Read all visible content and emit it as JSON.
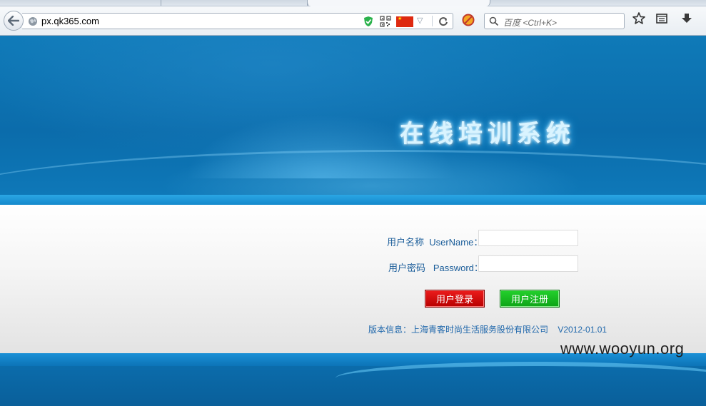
{
  "browser": {
    "url": "px.qk365.com",
    "search_placeholder": "百度 <Ctrl+K>",
    "icons": [
      "back-arrow-icon",
      "globe-icon",
      "shield-icon",
      "qr-code-icon",
      "china-flag-icon",
      "dropdown-arrow-icon",
      "reload-icon",
      "adblock-icon",
      "search-icon",
      "bookmark-star-icon",
      "reader-icon",
      "download-icon"
    ]
  },
  "banner": {
    "title": "在线培训系统"
  },
  "login": {
    "username_label": "用户名称  UserName：",
    "username_value": "",
    "password_label": "用户密码   Password：",
    "password_value": "",
    "login_button": "用户登录",
    "register_button": "用户注册",
    "version_info": "版本信息：上海青客时尚生活服务股份有限公司    V2012-01.01"
  },
  "watermark": "www.wooyun.org",
  "colors": {
    "banner_blue": "#0b6cab",
    "label_blue": "#1c5e9a",
    "login_red": "#d40000",
    "register_green": "#17b820"
  }
}
